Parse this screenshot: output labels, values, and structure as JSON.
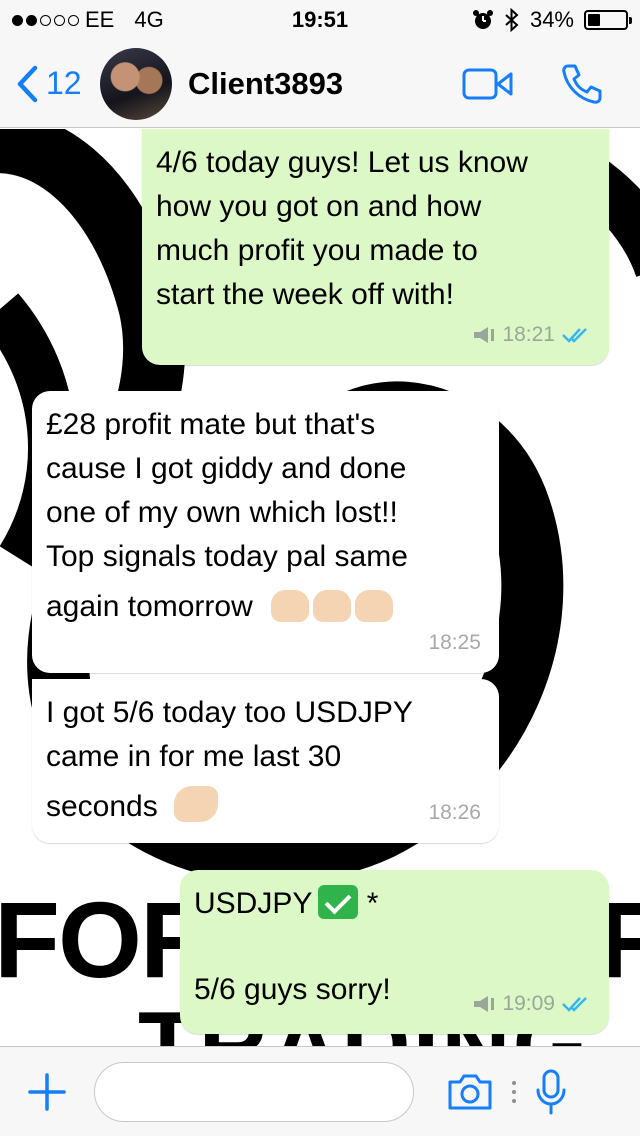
{
  "status_bar": {
    "carrier": "EE",
    "network": "4G",
    "time": "19:51",
    "battery": "34%",
    "battery_level": 0.34,
    "signal_bars_filled": 2,
    "signal_bars_total": 5
  },
  "nav": {
    "back_count": "12",
    "contact_name": "Client3893",
    "accent_color": "#157efb"
  },
  "wallpaper": {
    "line1": "FOR",
    "line1_right": "F",
    "line2": "TRADING"
  },
  "messages": [
    {
      "direction": "out",
      "lines": [
        "4/6 today guys! Let us know",
        "how you got on and how",
        "much profit you made to",
        "start the week off with!"
      ],
      "time": "18:21",
      "broadcast": true,
      "read": true
    },
    {
      "direction": "in",
      "lines": [
        "£28 profit mate but that's",
        "cause I got giddy and done",
        "one of my own which lost!!",
        "Top signals today pal same",
        "again tomorrow"
      ],
      "emoji": "raised-hands",
      "emoji_count": 3,
      "time": "18:25"
    },
    {
      "direction": "in",
      "lines": [
        "I got 5/6 today too USDJPY",
        "came in for me last 30",
        "seconds"
      ],
      "emoji": "clapping-hands",
      "time": "18:26"
    },
    {
      "direction": "out",
      "line1": "USDJPY",
      "line1_suffix": " *",
      "line2": "5/6 guys sorry!",
      "time": "19:09",
      "broadcast": true,
      "read": true
    }
  ],
  "input": {
    "value": ""
  },
  "colors": {
    "outgoing_bubble": "#dcf8c6",
    "incoming_bubble": "#ffffff",
    "read_ticks": "#34b7f1",
    "check_emoji": "#2fb34a"
  }
}
